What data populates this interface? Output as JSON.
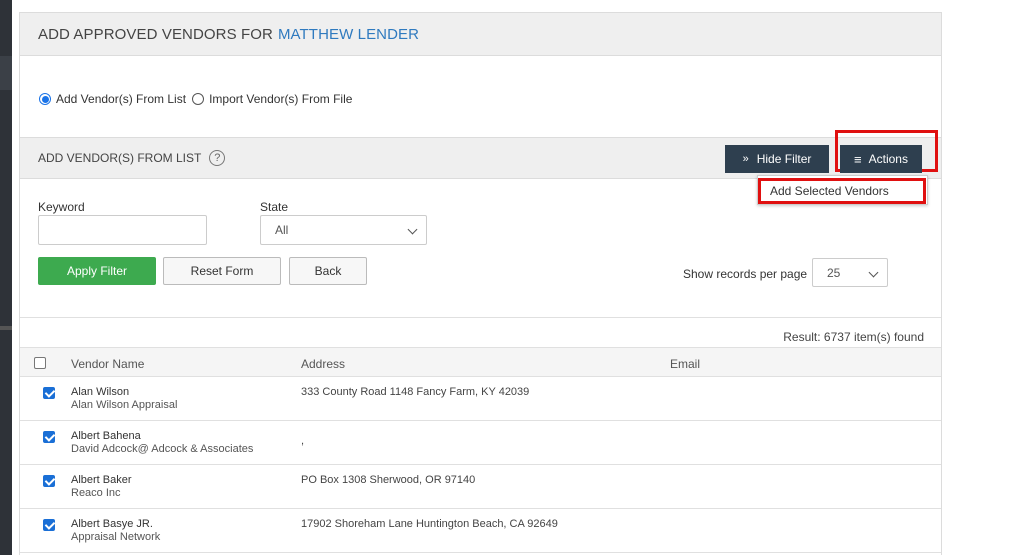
{
  "header": {
    "title_prefix": "ADD APPROVED VENDORS FOR",
    "title_name": "MATTHEW LENDER"
  },
  "mode": {
    "options": [
      {
        "label": "Add Vendor(s) From List",
        "selected": true
      },
      {
        "label": "Import Vendor(s) From File",
        "selected": false
      }
    ]
  },
  "section": {
    "title": "ADD VENDOR(S) FROM LIST",
    "help_glyph": "?",
    "hide_filter_label": "Hide Filter",
    "actions_label": "Actions",
    "actions_menu": [
      "Add Selected Vendors"
    ]
  },
  "filter": {
    "keyword_label": "Keyword",
    "keyword_value": "",
    "state_label": "State",
    "state_value": "All",
    "apply_label": "Apply Filter",
    "reset_label": "Reset Form",
    "back_label": "Back",
    "records_label": "Show records per page",
    "records_value": "25"
  },
  "result_text": "Result: 6737 item(s) found",
  "table": {
    "columns": [
      "Vendor Name",
      "Address",
      "Email"
    ],
    "rows": [
      {
        "checked": true,
        "name": "Alan Wilson",
        "company": "Alan Wilson Appraisal",
        "address": "333 County Road 1148 Fancy Farm, KY 42039",
        "email": ""
      },
      {
        "checked": true,
        "name": "Albert Bahena",
        "company": "David Adcock@ Adcock & Associates",
        "address": ",",
        "email": ""
      },
      {
        "checked": true,
        "name": "Albert Baker",
        "company": "Reaco Inc",
        "address": "PO Box 1308 Sherwood, OR 97140",
        "email": ""
      },
      {
        "checked": true,
        "name": "Albert Basye JR.",
        "company": "Appraisal Network",
        "address": "17902 Shoreham Lane Huntington Beach, CA 92649",
        "email": ""
      }
    ]
  },
  "colors": {
    "accent": "#2f7abf",
    "dark_button": "#2e3f4f",
    "apply_green": "#3daa4f",
    "highlight_red": "#e01010",
    "checkbox_blue": "#1a6fd6"
  }
}
